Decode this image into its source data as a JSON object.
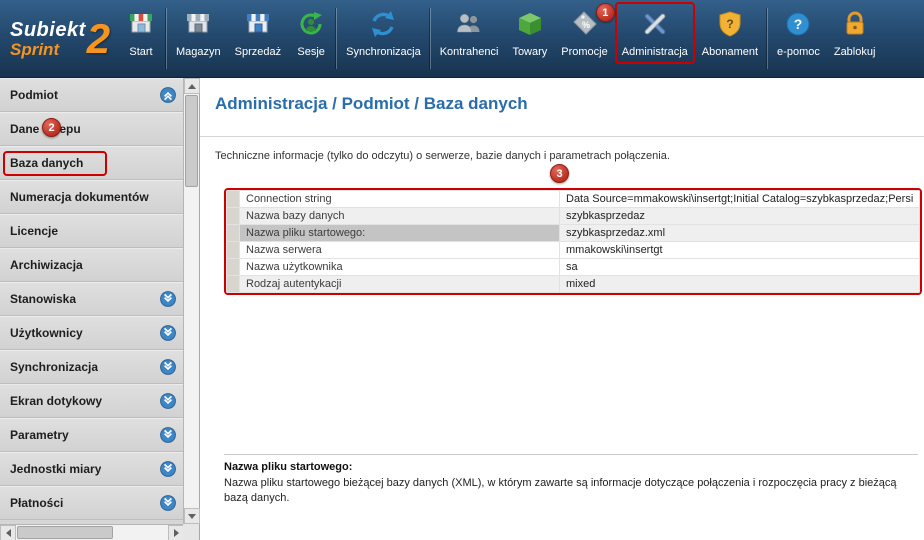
{
  "logo": {
    "line1": "Subiekt",
    "line2": "Sprint",
    "number": "2"
  },
  "toolbar": {
    "items": [
      {
        "label": "Start"
      },
      {
        "label": "Magazyn"
      },
      {
        "label": "Sprzedaż"
      },
      {
        "label": "Sesje"
      },
      {
        "label": "Synchronizacja"
      },
      {
        "label": "Kontrahenci"
      },
      {
        "label": "Towary"
      },
      {
        "label": "Promocje"
      },
      {
        "label": "Administracja"
      },
      {
        "label": "Abonament"
      },
      {
        "label": "e-pomoc"
      },
      {
        "label": "Zablokuj"
      }
    ]
  },
  "sidebar": {
    "items": [
      {
        "label": "Podmiot"
      },
      {
        "label": "Dane sklepu"
      },
      {
        "label": "Baza danych"
      },
      {
        "label": "Numeracja dokumentów"
      },
      {
        "label": "Licencje"
      },
      {
        "label": "Archiwizacja"
      },
      {
        "label": "Stanowiska"
      },
      {
        "label": "Użytkownicy"
      },
      {
        "label": "Synchronizacja"
      },
      {
        "label": "Ekran dotykowy"
      },
      {
        "label": "Parametry"
      },
      {
        "label": "Jednostki miary"
      },
      {
        "label": "Płatności"
      }
    ]
  },
  "main": {
    "title": "Administracja / Podmiot / Baza danych",
    "description": "Techniczne informacje (tylko do odczytu) o serwerze, bazie danych i parametrach połączenia.",
    "table": {
      "rows": [
        {
          "name": "Connection string",
          "value": "Data Source=mmakowski\\insertgt;Initial Catalog=szybkasprzedaz;Persi"
        },
        {
          "name": "Nazwa bazy danych",
          "value": "szybkasprzedaz"
        },
        {
          "name": "Nazwa pliku startowego:",
          "value": "szybkasprzedaz.xml"
        },
        {
          "name": "Nazwa serwera",
          "value": "mmakowski\\insertgt"
        },
        {
          "name": "Nazwa użytkownika",
          "value": "sa"
        },
        {
          "name": "Rodzaj autentykacji",
          "value": "mixed"
        }
      ]
    },
    "info": {
      "title": "Nazwa pliku startowego:",
      "text": "Nazwa pliku startowego bieżącej bazy danych (XML), w którym zawarte są informacje dotyczące połączenia i rozpoczęcia pracy z bieżącą bazą danych."
    }
  },
  "annotations": {
    "badge1": "1",
    "badge2": "2",
    "badge3": "3",
    "highlight_color": "#cc0000"
  }
}
